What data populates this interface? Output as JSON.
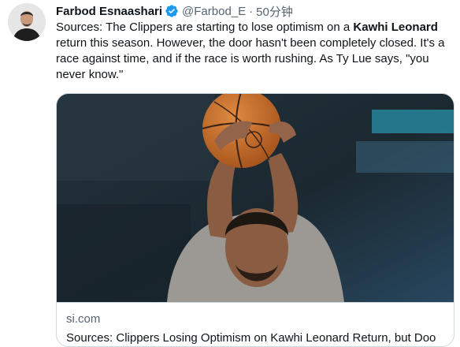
{
  "tweet": {
    "author_name": "Farbod Esnaashari",
    "handle": "@Farbod_E",
    "separator": "·",
    "time": "50分钟",
    "text_before": "Sources: The Clippers are starting to lose optimism on a ",
    "text_bold": "Kawhi Leonard",
    "text_after": " return this season.  However, the door hasn't been completely closed. It's a race against time, and if the race is worth rushing. As Ty Lue says, \"you never know.\""
  },
  "card": {
    "domain": "si.com",
    "title": "Sources: Clippers Losing Optimism on Kawhi Leonard Return, but Doo"
  },
  "colors": {
    "verified_blue": "#1d9bf0",
    "secondary_text": "#536471",
    "border": "#cfd9de"
  },
  "icons": {
    "verified": "verified-badge-icon"
  }
}
